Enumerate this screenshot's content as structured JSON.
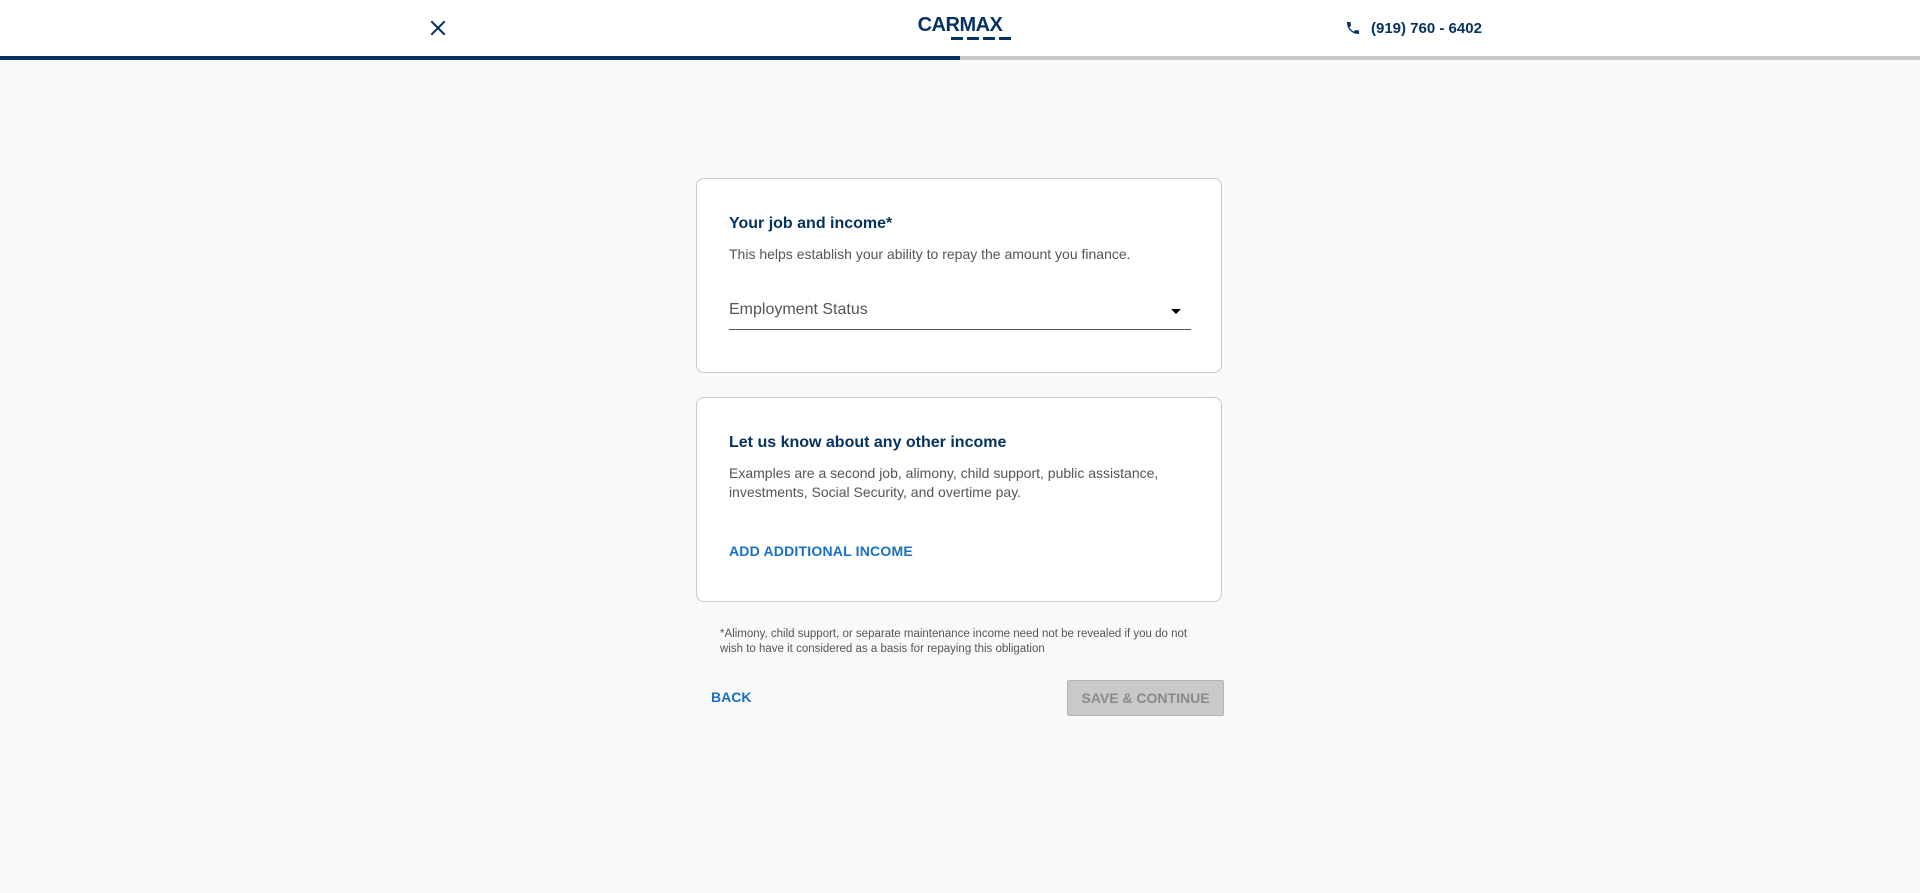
{
  "header": {
    "close_icon": "close-icon",
    "logo_text": "CARMAX",
    "phone_icon": "phone-icon",
    "phone_number": "(919) 760 - 6402",
    "progress_fraction": 0.5
  },
  "job_card": {
    "title": "Your job and income*",
    "description": "This helps establish your ability to repay the amount you finance.",
    "employment_status_label": "Employment Status",
    "caret_icon": "caret-down-icon"
  },
  "other_income_card": {
    "title": "Let us know about any other income",
    "description": "Examples are a second job, alimony, child support, public assistance, investments, Social Security, and overtime pay.",
    "add_button_label": "ADD ADDITIONAL INCOME"
  },
  "disclaimer": "*Alimony, child support, or separate maintenance income need not be revealed if you do not wish to have it considered as a basis for repaying this obligation",
  "actions": {
    "back_label": "BACK",
    "save_label": "SAVE & CONTINUE"
  },
  "colors": {
    "brand_navy": "#053361",
    "link_blue": "#1770c8",
    "disabled_gray": "#c9c9c9",
    "background": "#f9f9f9"
  }
}
